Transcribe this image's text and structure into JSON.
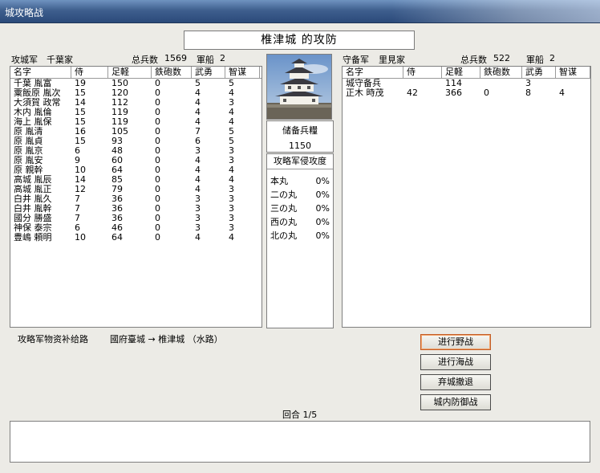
{
  "window": {
    "title": "城攻略战"
  },
  "castle_title": "椎津城 的攻防",
  "attacker": {
    "label": "攻城军",
    "lord": "千葉家",
    "total_label": "总兵数",
    "total": "1569",
    "ships_label": "軍船",
    "ships": "2"
  },
  "defender": {
    "label": "守备军",
    "lord": "里見家",
    "total_label": "总兵数",
    "total": "522",
    "ships_label": "軍船",
    "ships": "2"
  },
  "columns": [
    "名字",
    "侍",
    "足軽",
    "鉄砲数",
    "武勇",
    "智谋"
  ],
  "attacker_rows": [
    {
      "name": "千葉 胤富",
      "samurai": "19",
      "ashigaru": "150",
      "guns": "0",
      "valor": "5",
      "wisdom": "5"
    },
    {
      "name": "粟飯原 胤次",
      "samurai": "15",
      "ashigaru": "120",
      "guns": "0",
      "valor": "4",
      "wisdom": "4"
    },
    {
      "name": "大須賀 政常",
      "samurai": "14",
      "ashigaru": "112",
      "guns": "0",
      "valor": "4",
      "wisdom": "3"
    },
    {
      "name": "木内 胤倫",
      "samurai": "15",
      "ashigaru": "119",
      "guns": "0",
      "valor": "4",
      "wisdom": "4"
    },
    {
      "name": "海上 胤保",
      "samurai": "15",
      "ashigaru": "119",
      "guns": "0",
      "valor": "4",
      "wisdom": "4"
    },
    {
      "name": "原 胤清",
      "samurai": "16",
      "ashigaru": "105",
      "guns": "0",
      "valor": "7",
      "wisdom": "5"
    },
    {
      "name": "原 胤貞",
      "samurai": "15",
      "ashigaru": "93",
      "guns": "0",
      "valor": "6",
      "wisdom": "5"
    },
    {
      "name": "原 胤京",
      "samurai": "6",
      "ashigaru": "48",
      "guns": "0",
      "valor": "3",
      "wisdom": "3"
    },
    {
      "name": "原 胤安",
      "samurai": "9",
      "ashigaru": "60",
      "guns": "0",
      "valor": "4",
      "wisdom": "3"
    },
    {
      "name": "原 親幹",
      "samurai": "10",
      "ashigaru": "64",
      "guns": "0",
      "valor": "4",
      "wisdom": "4"
    },
    {
      "name": "高城 胤辰",
      "samurai": "14",
      "ashigaru": "85",
      "guns": "0",
      "valor": "4",
      "wisdom": "4"
    },
    {
      "name": "高城 胤正",
      "samurai": "12",
      "ashigaru": "79",
      "guns": "0",
      "valor": "4",
      "wisdom": "3"
    },
    {
      "name": "白井 胤久",
      "samurai": "7",
      "ashigaru": "36",
      "guns": "0",
      "valor": "3",
      "wisdom": "3"
    },
    {
      "name": "白井 胤幹",
      "samurai": "7",
      "ashigaru": "36",
      "guns": "0",
      "valor": "3",
      "wisdom": "3"
    },
    {
      "name": "國分 勝盛",
      "samurai": "7",
      "ashigaru": "36",
      "guns": "0",
      "valor": "3",
      "wisdom": "3"
    },
    {
      "name": "神保 泰宗",
      "samurai": "6",
      "ashigaru": "46",
      "guns": "0",
      "valor": "3",
      "wisdom": "3"
    },
    {
      "name": "豊嶋 頼明",
      "samurai": "10",
      "ashigaru": "64",
      "guns": "0",
      "valor": "4",
      "wisdom": "4"
    }
  ],
  "defender_rows": [
    {
      "name": "城守备兵",
      "samurai": "",
      "ashigaru": "114",
      "guns": "",
      "valor": "3",
      "wisdom": ""
    },
    {
      "name": "正木 時茂",
      "samurai": "42",
      "ashigaru": "366",
      "guns": "0",
      "valor": "8",
      "wisdom": "4"
    }
  ],
  "food": {
    "label": "储备兵糧",
    "value": "1150"
  },
  "invasion": {
    "title": "攻略军侵攻度",
    "items": [
      {
        "name": "本丸",
        "value": "0%"
      },
      {
        "name": "二の丸",
        "value": "0%"
      },
      {
        "name": "三の丸",
        "value": "0%"
      },
      {
        "name": "西の丸",
        "value": "0%"
      },
      {
        "name": "北の丸",
        "value": "0%"
      }
    ]
  },
  "supply": {
    "label": "攻略军物资补给路",
    "route": "國府臺城 → 椎津城 （水路）"
  },
  "buttons": {
    "field": "进行野战",
    "naval": "进行海战",
    "abandon": "弃城撤退",
    "defend": "城内防御战"
  },
  "turn": "回合 1/5"
}
